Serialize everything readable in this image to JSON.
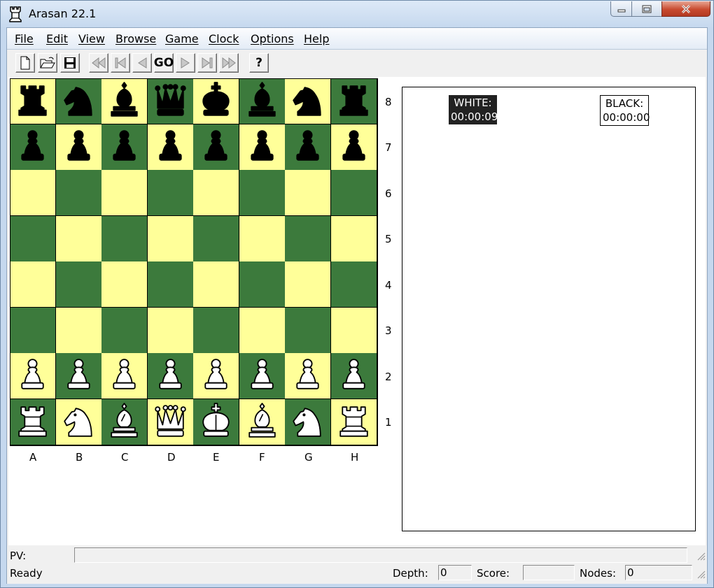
{
  "window": {
    "title": "Arasan 22.1"
  },
  "menu": [
    "File",
    "Edit",
    "View",
    "Browse",
    "Game",
    "Clock",
    "Options",
    "Help"
  ],
  "toolbar": {
    "go_label": "GO",
    "help_label": "?"
  },
  "board": {
    "ranks": [
      "8",
      "7",
      "6",
      "5",
      "4",
      "3",
      "2",
      "1"
    ],
    "files": [
      "A",
      "B",
      "C",
      "D",
      "E",
      "F",
      "G",
      "H"
    ],
    "light_color": "#ffff99",
    "dark_color": "#3c7a3c",
    "position": [
      [
        "br",
        "bn",
        "bb",
        "bq",
        "bk",
        "bb",
        "bn",
        "br"
      ],
      [
        "bp",
        "bp",
        "bp",
        "bp",
        "bp",
        "bp",
        "bp",
        "bp"
      ],
      [
        "",
        "",
        "",
        "",
        "",
        "",
        "",
        ""
      ],
      [
        "",
        "",
        "",
        "",
        "",
        "",
        "",
        ""
      ],
      [
        "",
        "",
        "",
        "",
        "",
        "",
        "",
        ""
      ],
      [
        "",
        "",
        "",
        "",
        "",
        "",
        "",
        ""
      ],
      [
        "wp",
        "wp",
        "wp",
        "wp",
        "wp",
        "wp",
        "wp",
        "wp"
      ],
      [
        "wr",
        "wn",
        "wb",
        "wq",
        "wk",
        "wb",
        "wn",
        "wr"
      ]
    ]
  },
  "clocks": {
    "white_label": "WHITE:",
    "white_time": "00:00:09",
    "black_label": "BLACK:",
    "black_time": "00:00:00"
  },
  "status": {
    "pv_label": "PV:",
    "pv_value": "",
    "ready": "Ready",
    "depth_label": "Depth:",
    "depth_value": "0",
    "score_label": "Score:",
    "score_value": "",
    "nodes_label": "Nodes:",
    "nodes_value": "0"
  }
}
